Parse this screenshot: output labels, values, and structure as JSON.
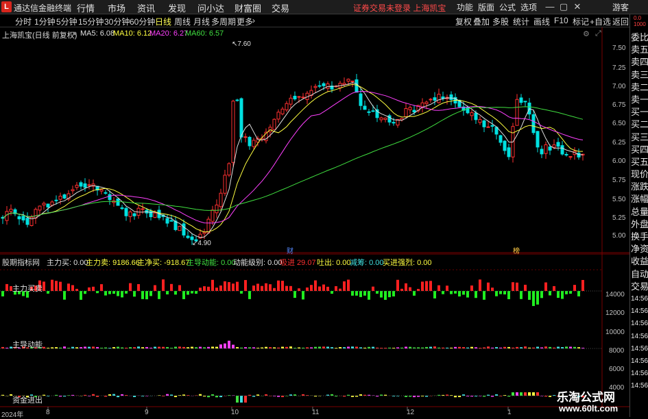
{
  "app": {
    "name": "通达信金融终端",
    "logo": "L",
    "notice": "证券交易未登录 上海凯宝"
  },
  "menu": [
    "行情",
    "市场",
    "资讯",
    "发现",
    "问小达",
    "财富圈",
    "交易"
  ],
  "right_menu": [
    "功能",
    "版面",
    "公式",
    "选项",
    "游客"
  ],
  "tabs": [
    "分时",
    "1分钟",
    "5分钟",
    "15分钟",
    "30分钟",
    "60分钟",
    "日线",
    "周线",
    "月线",
    "多周期",
    "更多"
  ],
  "toolbar_right": [
    "复权",
    "叠加",
    "多股",
    "统计",
    "画线",
    "F10",
    "标记",
    "+自选",
    "返回"
  ],
  "chart": {
    "title": "上海凯宝(日线 前复权)",
    "ma5": "MA5: 6.08",
    "ma10": "MA10: 6.12",
    "ma20": "MA20: 6.27",
    "ma60": "MA60: 6.57",
    "high_label": "7.60",
    "low_label": "4.90",
    "event1": "财",
    "event2": "榜"
  },
  "ind": {
    "title": "股期指标网",
    "a": "主力买: 0.00",
    "b": "主力卖: 9186.66",
    "c": "主净买: -918.67",
    "d": "主导动能: 0.00",
    "e": "动能级别: 0.00",
    "f": "吸进 29.07",
    "g": "吐出: 0.00",
    "h": "减筹: 0.00",
    "i": "买进强烈: 0.00"
  },
  "sub_labels": [
    "主力买卖",
    "主导动能",
    "资金进出"
  ],
  "price_axis": [
    "7.50",
    "7.25",
    "7.00",
    "6.75",
    "6.50",
    "6.25",
    "6.00",
    "5.75",
    "5.50",
    "5.25",
    "5.00"
  ],
  "ind_axis": [
    "14000",
    "12000",
    "10000",
    "8000",
    "6000",
    "4000"
  ],
  "x_axis": [
    "2024年",
    "8",
    "9",
    "10",
    "11",
    "12",
    "1"
  ],
  "side": [
    "委比",
    "卖五",
    "卖四",
    "卖三",
    "卖二",
    "卖一",
    "买一",
    "买二",
    "买三",
    "买四",
    "买五",
    "现价",
    "涨跌",
    "涨幅",
    "总量",
    "外盘",
    "换手",
    "净资",
    "收益",
    "自动",
    "交易",
    "14:56",
    "14:56",
    "14:56",
    "14:56",
    "14:56",
    "14:56",
    "14:56",
    "14:56"
  ],
  "side_top": "0.0",
  "side_top2": "1000",
  "watermark": {
    "title": "乐淘公式网",
    "url": "www.60lt.com"
  },
  "colors": {
    "up": "#ff3030",
    "down": "#00e0e0",
    "ma5": "#e0e0e0",
    "ma10": "#ffff40",
    "ma20": "#ff40ff",
    "ma60": "#40e040"
  }
}
